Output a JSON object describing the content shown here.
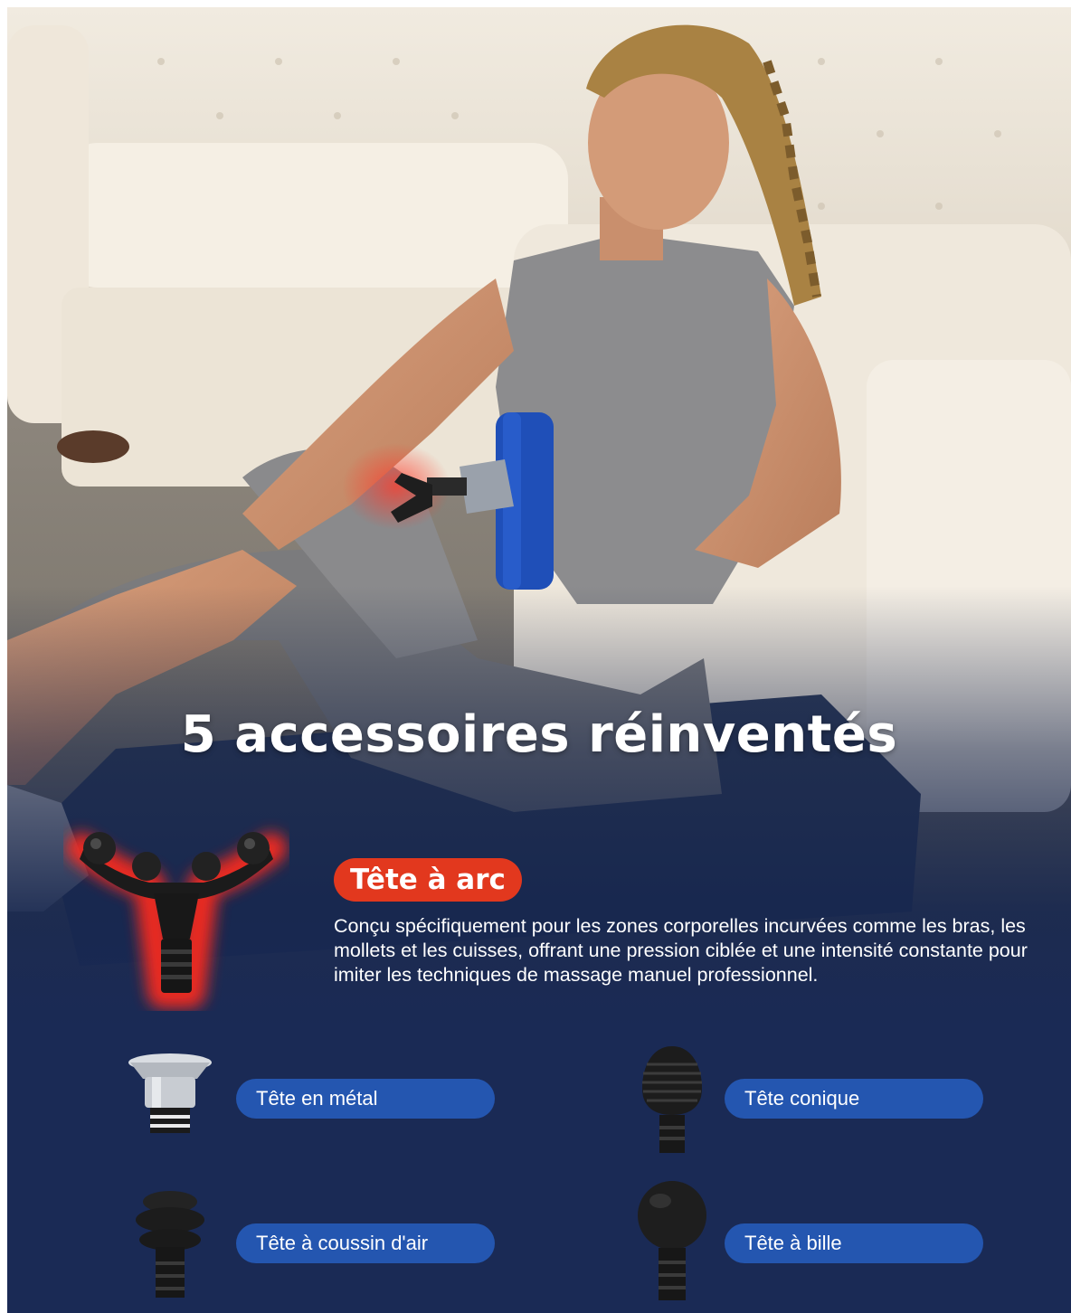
{
  "headline": "5 accessoires réinventés",
  "featured": {
    "name": "Tête à arc",
    "description": "Conçu spécifiquement pour les zones corporelles incurvées comme les bras, les mollets et les cuisses, offrant une pression ciblée et une intensité constante pour imiter les techniques de massage manuel professionnel."
  },
  "accessories": [
    {
      "label": "Tête en métal",
      "icon": "metal-head-icon"
    },
    {
      "label": "Tête conique",
      "icon": "conical-head-icon"
    },
    {
      "label": "Tête à coussin d'air",
      "icon": "air-cushion-head-icon"
    },
    {
      "label": "Tête à bille",
      "icon": "ball-head-icon"
    }
  ],
  "colors": {
    "featured_badge": "#e2381e",
    "label_pill": "#2456b0",
    "panel": "#1a2a55",
    "device": "#1f4fb8"
  }
}
